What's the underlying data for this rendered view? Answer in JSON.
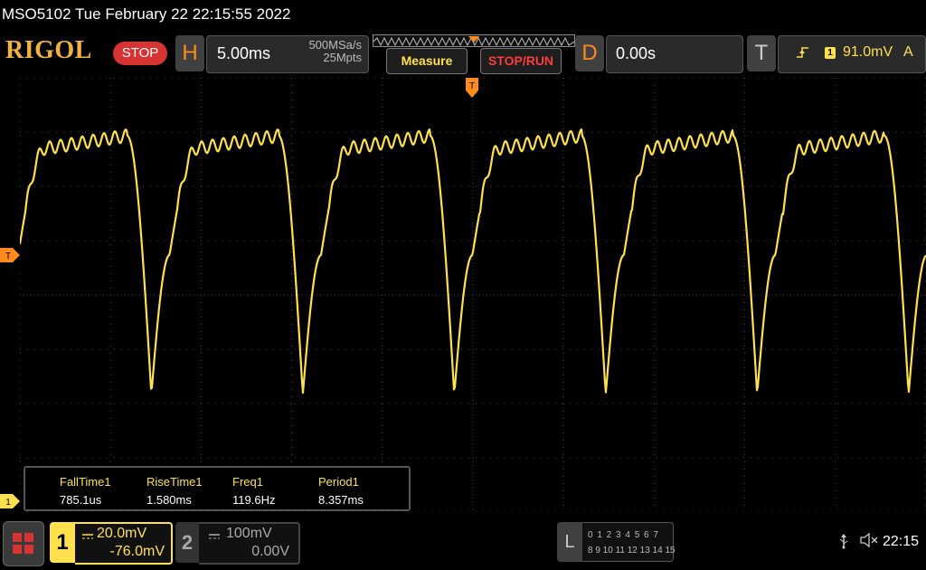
{
  "title_bar": {
    "text": "MSO5102  Tue February 22 22:15:55 2022"
  },
  "toolbar": {
    "logo": "RIGOL",
    "status": "STOP",
    "horizontal": {
      "letter": "H",
      "scale": "5.00ms",
      "sample_rate": "500MSa/s",
      "memory_depth": "25Mpts"
    },
    "measure_label": "Measure",
    "stop_run_label": "STOP/RUN",
    "delay": {
      "letter": "D",
      "value": "0.00s"
    },
    "trigger": {
      "letter": "T",
      "source": "1",
      "level": "91.0mV",
      "mode": "A"
    }
  },
  "markers": {
    "trigger_top": "T",
    "trigger_left": "T",
    "channel1": "1"
  },
  "measurements": [
    {
      "label": "FallTime1",
      "value": "785.1us"
    },
    {
      "label": "RiseTime1",
      "value": "1.580ms"
    },
    {
      "label": "Freq1",
      "value": "119.6Hz"
    },
    {
      "label": "Period1",
      "value": "8.357ms"
    }
  ],
  "channels": [
    {
      "number": "1",
      "scale": "20.0mV",
      "offset": "-76.0mV",
      "color": "#ffe14d",
      "active": true
    },
    {
      "number": "2",
      "scale": "100mV",
      "offset": "0.00V",
      "color": "#aaaaaa",
      "active": false
    }
  ],
  "logic_analyzer": {
    "letter": "L",
    "row1": "0 1 2 3  4 5 6 7",
    "row2": "8 9 10 11 12 13 14 15"
  },
  "status_bar": {
    "time": "22:15"
  },
  "icons": {
    "usb": "usb-icon",
    "speaker": "speaker-muted-icon",
    "menu": "menu-grid-icon"
  },
  "colors": {
    "trace": "#ffe14d",
    "accent": "#ff8c1a",
    "stop": "#d83333",
    "grid": "#555555"
  },
  "waveform": {
    "period_ms": 8.357,
    "time_per_div_ms": 5.0,
    "amplitude_mV_per_div": 20.0
  }
}
